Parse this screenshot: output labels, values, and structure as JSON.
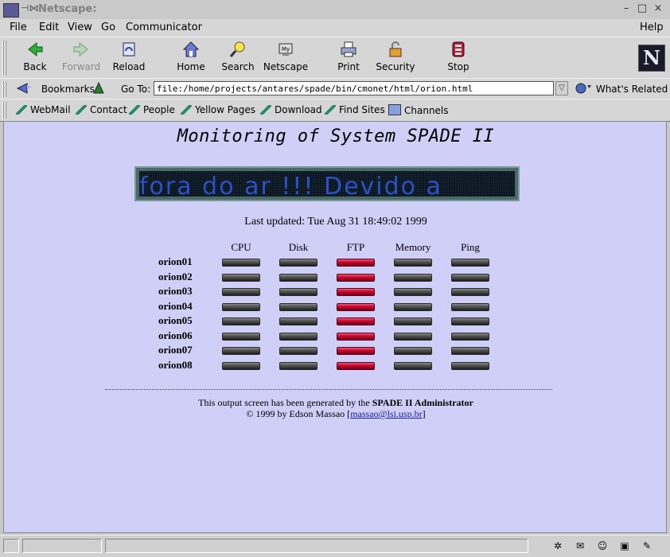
{
  "window": {
    "title": "Netscape:",
    "buttons": {
      "minimize": "–",
      "maximize": "□",
      "close": "×"
    }
  },
  "menubar": {
    "items": [
      "File",
      "Edit",
      "View",
      "Go",
      "Communicator"
    ],
    "help": "Help"
  },
  "toolbar": {
    "back": "Back",
    "forward": "Forward",
    "reload": "Reload",
    "home": "Home",
    "search": "Search",
    "netscape": "Netscape",
    "print": "Print",
    "security": "Security",
    "stop": "Stop",
    "logo_letter": "N"
  },
  "location": {
    "bookmarks_label": "Bookmarks",
    "goto_label": "Go To:",
    "url": "file:/home/projects/antares/spade/bin/cmonet/html/orion.html",
    "whats_related": "What's Related"
  },
  "personal_toolbar": {
    "links": [
      "WebMail",
      "Contact",
      "People",
      "Yellow Pages",
      "Download",
      "Find Sites",
      "Channels"
    ]
  },
  "page": {
    "title": "Monitoring of System SPADE II",
    "marquee_text": "fora do ar !!! Devido a",
    "last_updated": "Last updated: Tue Aug 31 18:49:02 1999",
    "columns": [
      "CPU",
      "Disk",
      "FTP",
      "Memory",
      "Ping"
    ],
    "hosts": [
      {
        "name": "orion01",
        "status": [
          "gray",
          "gray",
          "red",
          "gray",
          "gray"
        ]
      },
      {
        "name": "orion02",
        "status": [
          "gray",
          "gray",
          "red",
          "gray",
          "gray"
        ]
      },
      {
        "name": "orion03",
        "status": [
          "gray",
          "gray",
          "red",
          "gray",
          "gray"
        ]
      },
      {
        "name": "orion04",
        "status": [
          "gray",
          "gray",
          "red",
          "gray",
          "gray"
        ]
      },
      {
        "name": "orion05",
        "status": [
          "gray",
          "gray",
          "red",
          "gray",
          "gray"
        ]
      },
      {
        "name": "orion06",
        "status": [
          "gray",
          "gray",
          "red",
          "gray",
          "gray"
        ]
      },
      {
        "name": "orion07",
        "status": [
          "gray",
          "gray",
          "red",
          "gray",
          "gray"
        ]
      },
      {
        "name": "orion08",
        "status": [
          "gray",
          "gray",
          "red",
          "gray",
          "gray"
        ]
      }
    ],
    "footer": {
      "line1_prefix": "This output screen has been generated by the ",
      "line1_bold": "SPADE II Administrator",
      "line2_prefix": "© 1999 by Edson Massao [",
      "email": "massao@lsi.usp.br",
      "line2_suffix": "]"
    },
    "colors": {
      "background": "#cfcff7",
      "alert": "#d0103a",
      "ok": "#4a4a4a"
    }
  }
}
